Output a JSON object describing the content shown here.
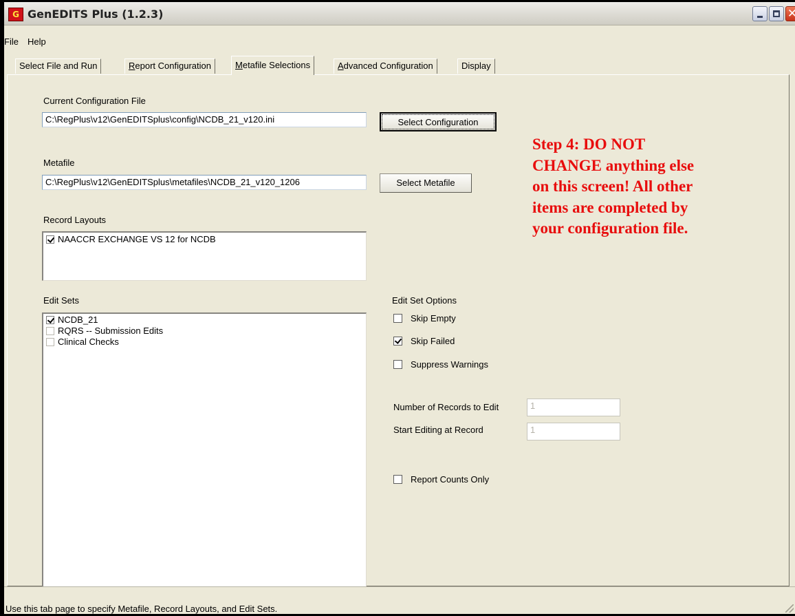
{
  "window": {
    "icon_text": "G",
    "title": "GenEDITS Plus (1.2.3)",
    "close_glyph": "✕"
  },
  "menu": [
    "File",
    "Help"
  ],
  "tabs": [
    {
      "label": "Select File and Run",
      "accel": "",
      "rest": "Select File and Run",
      "active": false
    },
    {
      "label": "Report Configuration",
      "accel": "R",
      "rest": "eport Configuration",
      "active": false
    },
    {
      "label": "Metafile Selections",
      "accel": "M",
      "rest": "etafile Selections",
      "active": true
    },
    {
      "label": "Advanced Configuration",
      "accel": "A",
      "rest": "dvanced Configuration",
      "active": false
    },
    {
      "label": "Display",
      "accel": "",
      "rest": "Display",
      "active": false
    }
  ],
  "config": {
    "label": "Current Configuration File",
    "value": "C:\\RegPlus\\v12\\GenEDITSplus\\config\\NCDB_21_v120.ini",
    "button": "Select Configuration"
  },
  "metafile": {
    "label": "Metafile",
    "value": "C:\\RegPlus\\v12\\GenEDITSplus\\metafiles\\NCDB_21_v120_1206",
    "button": "Select Metafile"
  },
  "record_layouts": {
    "label": "Record Layouts",
    "items": [
      {
        "label": "NAACCR EXCHANGE VS 12 for NCDB",
        "checked": true
      }
    ]
  },
  "edit_sets": {
    "label": "Edit Sets",
    "items": [
      {
        "label": "NCDB_21",
        "checked": true
      },
      {
        "label": "RQRS -- Submission Edits",
        "checked": false
      },
      {
        "label": "Clinical Checks",
        "checked": false
      }
    ]
  },
  "edit_set_options": {
    "label": "Edit Set Options",
    "skip_empty": {
      "label": "Skip Empty",
      "checked": false
    },
    "skip_failed": {
      "label": "Skip Failed",
      "checked": true
    },
    "suppress_warnings": {
      "label": "Suppress Warnings",
      "checked": false
    }
  },
  "records": {
    "num_label": "Number of Records to Edit",
    "num_value": "1",
    "start_label": "Start Editing at Record",
    "start_value": "1"
  },
  "report_counts_only": {
    "label": "Report Counts Only",
    "checked": false
  },
  "note": {
    "lines": [
      "Step 4: DO NOT",
      "CHANGE anything else",
      "on this screen!  All other",
      "items are completed by",
      "your configuration file."
    ],
    "color": "#e80d0d"
  },
  "status": "Use this tab page to specify Metafile, Record Layouts, and Edit Sets."
}
